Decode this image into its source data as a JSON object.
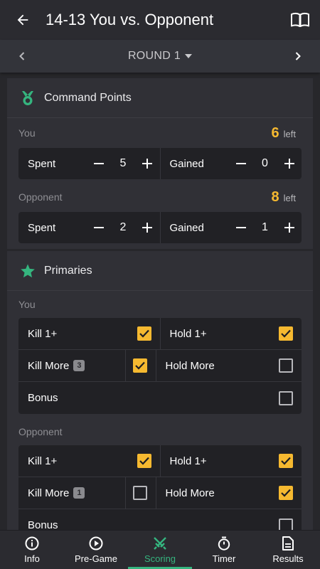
{
  "header": {
    "title": "14-13 You vs. Opponent",
    "back_icon": "arrow-left-icon",
    "rules_icon": "book-icon"
  },
  "round": {
    "label": "ROUND 1",
    "prev_icon": "chevron-left-icon",
    "next_icon": "chevron-right-icon"
  },
  "command_points": {
    "title": "Command Points",
    "icon": "medal-icon",
    "you": {
      "who": "You",
      "left_value": "6",
      "left_label": "left",
      "spent_label": "Spent",
      "spent_value": "5",
      "gained_label": "Gained",
      "gained_value": "0"
    },
    "opponent": {
      "who": "Opponent",
      "left_value": "8",
      "left_label": "left",
      "spent_label": "Spent",
      "spent_value": "2",
      "gained_label": "Gained",
      "gained_value": "1"
    }
  },
  "primaries": {
    "title": "Primaries",
    "icon": "star-icon",
    "you": {
      "who": "You",
      "kill1": {
        "label": "Kill 1+",
        "checked": true
      },
      "hold1": {
        "label": "Hold 1+",
        "checked": true
      },
      "killmore": {
        "label": "Kill More",
        "badge": "3",
        "checked": true
      },
      "holdmore": {
        "label": "Hold More",
        "checked": false
      },
      "bonus": {
        "label": "Bonus",
        "checked": false
      }
    },
    "opponent": {
      "who": "Opponent",
      "kill1": {
        "label": "Kill 1+",
        "checked": true
      },
      "hold1": {
        "label": "Hold 1+",
        "checked": true
      },
      "killmore": {
        "label": "Kill More",
        "badge": "1",
        "checked": false
      },
      "holdmore": {
        "label": "Hold More",
        "checked": true
      },
      "bonus": {
        "label": "Bonus",
        "checked": false
      }
    }
  },
  "tabs": [
    {
      "label": "Info",
      "icon": "info-icon"
    },
    {
      "label": "Pre-Game",
      "icon": "play-circle-icon"
    },
    {
      "label": "Scoring",
      "icon": "crossed-swords-icon",
      "active": true
    },
    {
      "label": "Timer",
      "icon": "stopwatch-icon"
    },
    {
      "label": "Results",
      "icon": "document-icon"
    }
  ],
  "colors": {
    "accent": "#35b57f",
    "highlight": "#f6b930",
    "background": "#27272b",
    "surface": "#303036"
  }
}
